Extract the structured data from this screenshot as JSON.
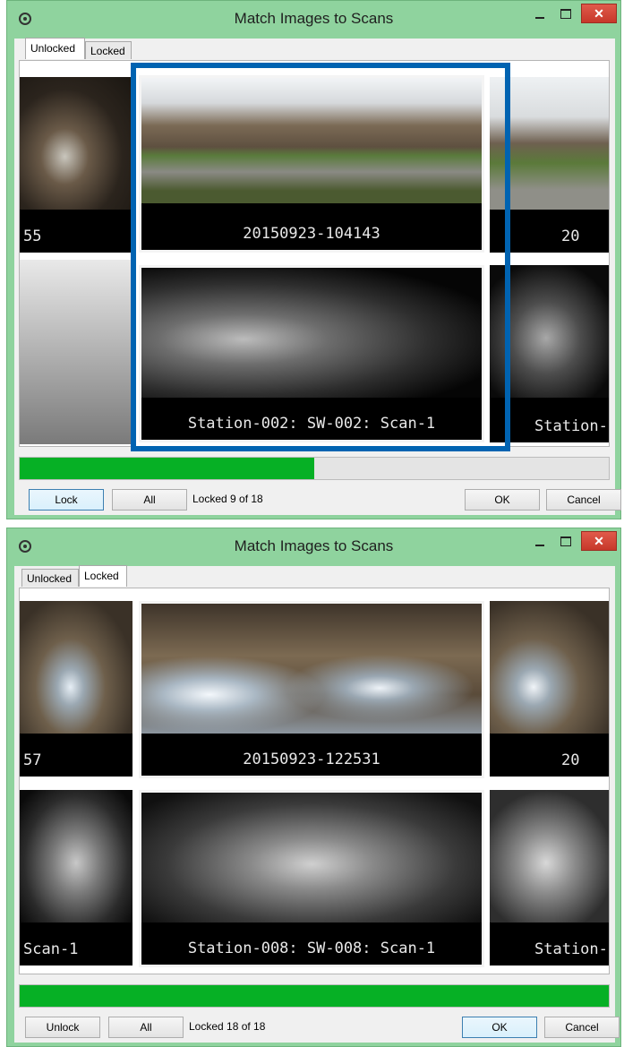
{
  "window1": {
    "title": "Match Images to Scans",
    "tabs": [
      {
        "label": "Unlocked",
        "active": true
      },
      {
        "label": "Locked",
        "active": false
      }
    ],
    "images_row": [
      {
        "label": "55"
      },
      {
        "label": "20150923-104143"
      },
      {
        "label": "20"
      }
    ],
    "scans_row": [
      {
        "label": ""
      },
      {
        "label": "Station-002: SW-002: Scan-1"
      },
      {
        "label": "Station-("
      }
    ],
    "progress_percent": 50,
    "buttons": {
      "lock": "Lock",
      "all": "All",
      "ok": "OK",
      "cancel": "Cancel"
    },
    "status": "Locked 9 of 18",
    "highlight_color": "#0063b1"
  },
  "window2": {
    "title": "Match Images to Scans",
    "tabs": [
      {
        "label": "Unlocked",
        "active": false
      },
      {
        "label": "Locked",
        "active": true
      }
    ],
    "images_row": [
      {
        "label": "57"
      },
      {
        "label": "20150923-122531"
      },
      {
        "label": "20"
      }
    ],
    "scans_row": [
      {
        "label": "Scan-1"
      },
      {
        "label": "Station-008: SW-008: Scan-1"
      },
      {
        "label": "Station-("
      }
    ],
    "progress_percent": 100,
    "buttons": {
      "unlock": "Unlock",
      "all": "All",
      "ok": "OK",
      "cancel": "Cancel"
    },
    "status": "Locked 18 of 18"
  },
  "colors": {
    "window_frame": "#8fd39e",
    "progress": "#06b025",
    "close_button": "#c7382a"
  }
}
